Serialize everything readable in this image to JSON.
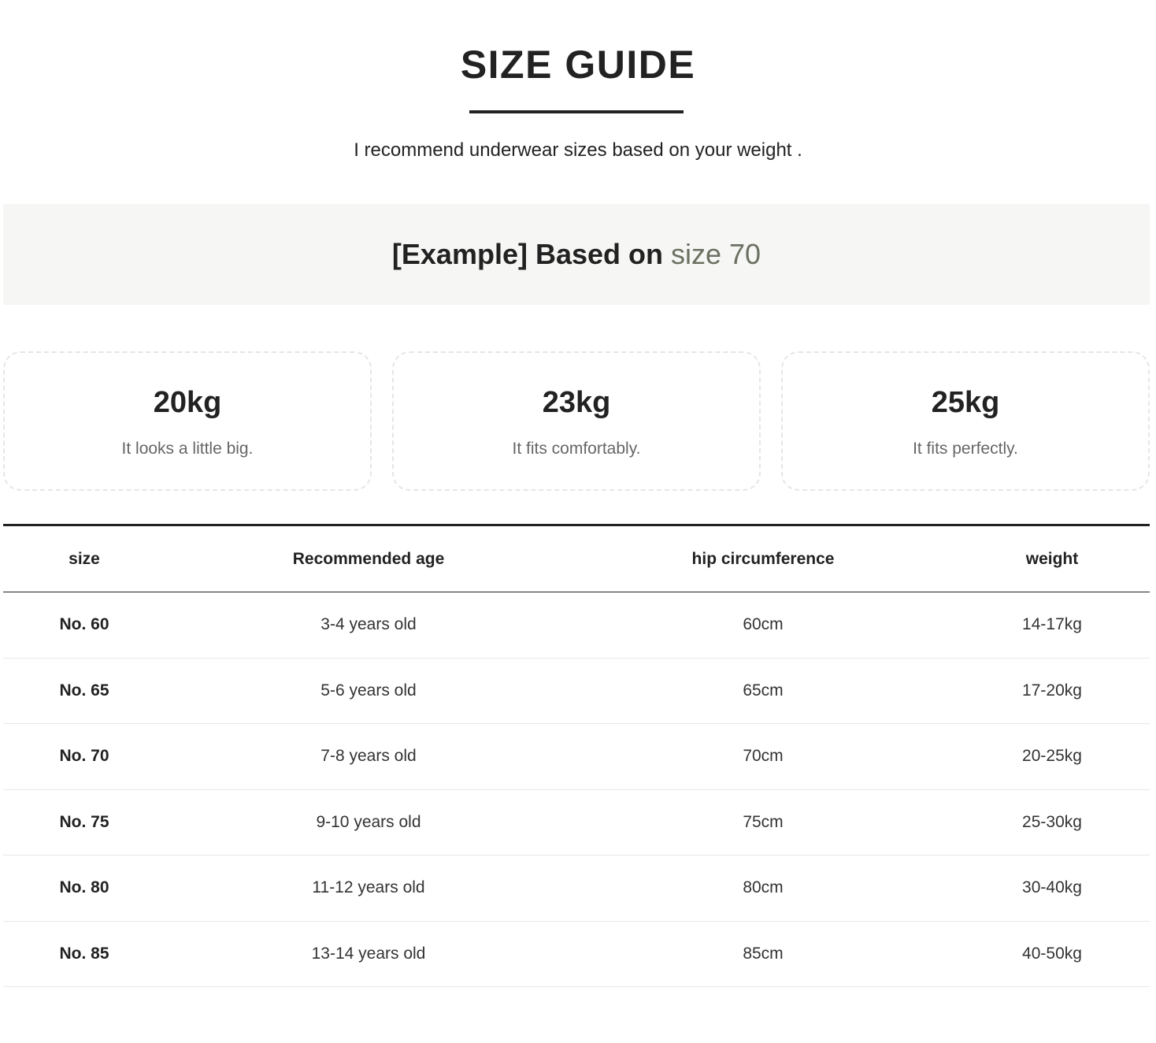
{
  "header": {
    "title": "SIZE GUIDE",
    "subtitle": "I recommend underwear sizes based on your weight ."
  },
  "example": {
    "lead": "[Example] Based on ",
    "accent": "size 70",
    "accent_color": "#6b7161"
  },
  "cards": [
    {
      "weight": "20kg",
      "note": "It looks a little big."
    },
    {
      "weight": "23kg",
      "note": "It fits comfortably."
    },
    {
      "weight": "25kg",
      "note": "It fits perfectly."
    }
  ],
  "table": {
    "headers": [
      "size",
      "Recommended age",
      "hip circumference",
      "weight"
    ],
    "rows": [
      [
        "No. 60",
        "3-4 years old",
        "60cm",
        "14-17kg"
      ],
      [
        "No. 65",
        "5-6 years old",
        "65cm",
        "17-20kg"
      ],
      [
        "No. 70",
        "7-8 years old",
        "70cm",
        "20-25kg"
      ],
      [
        "No. 75",
        "9-10 years old",
        "75cm",
        "25-30kg"
      ],
      [
        "No. 80",
        "11-12 years old",
        "80cm",
        "30-40kg"
      ],
      [
        "No. 85",
        "13-14 years old",
        "85cm",
        "40-50kg"
      ]
    ]
  }
}
